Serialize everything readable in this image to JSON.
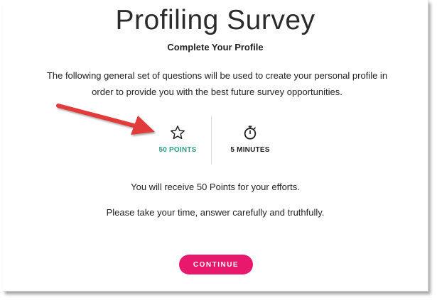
{
  "page": {
    "title": "Profiling Survey",
    "subtitle": "Complete Your Profile",
    "intro": "The following general set of questions will be used to create your personal profile in order to provide you with the best future survey opportunities."
  },
  "stats": {
    "points": {
      "icon": "star-outline-icon",
      "label": "50 POINTS"
    },
    "time": {
      "icon": "stopwatch-icon",
      "label": "5 MINUTES"
    }
  },
  "info": {
    "reward": "You will receive 50 Points for your efforts.",
    "advice": "Please take your time, answer carefully and truthfully."
  },
  "actions": {
    "continue_label": "CONTINUE"
  },
  "colors": {
    "accent": "#e8196c",
    "points": "#2e9c87",
    "annotation_arrow": "#e23b3b"
  }
}
